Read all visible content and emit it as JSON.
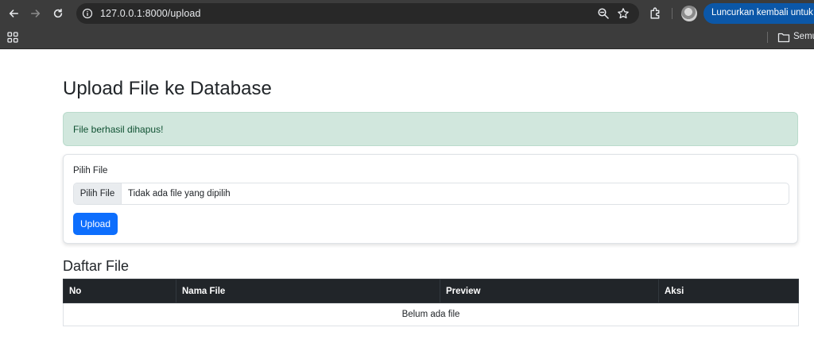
{
  "browser": {
    "url": "127.0.0.1:8000/upload",
    "relaunch_label": "Luncurkan kembali untuk meng",
    "bookmarks_label": "Semua"
  },
  "page": {
    "title": "Upload File ke Database",
    "alert_message": "File berhasil dihapus!",
    "form": {
      "label": "Pilih File",
      "file_button": "Pilih File",
      "file_status": "Tidak ada file yang dipilih",
      "upload_button": "Upload"
    },
    "list_title": "Daftar File",
    "table": {
      "headers": [
        "No",
        "Nama File",
        "Preview",
        "Aksi"
      ],
      "empty_message": "Belum ada file"
    }
  },
  "colors": {
    "primary": "#0d6efd",
    "success_bg": "#d1e7dd",
    "table_header_bg": "#212529"
  }
}
